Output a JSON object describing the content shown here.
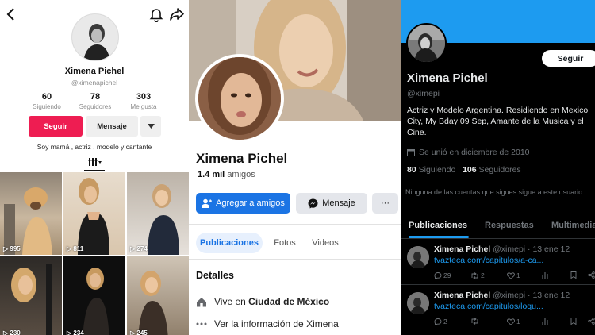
{
  "tiktok": {
    "name": "Ximena Pichel",
    "handle": "@ximenapichel",
    "stats": [
      {
        "value": "60",
        "label": "Siguiendo"
      },
      {
        "value": "78",
        "label": "Seguidores"
      },
      {
        "value": "303",
        "label": "Me gusta"
      }
    ],
    "follow_label": "Seguir",
    "message_label": "Mensaje",
    "bio": "Soy mamá , actriz , modelo y cantante",
    "videos": [
      {
        "views": "995"
      },
      {
        "views": "811"
      },
      {
        "views": "274"
      },
      {
        "views": "230"
      },
      {
        "views": "234"
      },
      {
        "views": "245"
      }
    ],
    "brand_color": "#ee1d52"
  },
  "facebook": {
    "name": "Ximena Pichel",
    "friends_count": "1.4 mil",
    "friends_label": "amigos",
    "add_friend_label": "Agregar a amigos",
    "message_label": "Mensaje",
    "more_label": "···",
    "tabs": [
      "Publicaciones",
      "Fotos",
      "Videos"
    ],
    "details_title": "Detalles",
    "lives_prefix": "Vive en",
    "lives_city": "Ciudad de México",
    "see_info": "Ver la información de Ximena",
    "brand_color": "#1b74e4"
  },
  "twitter": {
    "follow_label": "Seguir",
    "name": "Ximena Pichel",
    "handle": "@ximepi",
    "bio": "Actriz y Modelo Argentina. Residiendo en Mexico City, My Bday 09 Sep,  Amante de la Musica y el Cine.",
    "joined": "Se unió en diciembre de 2010",
    "following_count": "80",
    "following_label": "Siguiendo",
    "followers_count": "106",
    "followers_label": "Seguidores",
    "note": "Ninguna de las cuentas que sigues sigue a este usuario",
    "tabs": [
      "Publicaciones",
      "Respuestas",
      "Multimedia"
    ],
    "tweets": [
      {
        "name": "Ximena Pichel",
        "meta": "@ximepi · 13 ene 12",
        "link": "tvazteca.com/capitulos/a-ca...",
        "replies": "29",
        "retweets": "2",
        "likes": "1"
      },
      {
        "name": "Ximena Pichel",
        "meta": "@ximepi · 13 ene 12",
        "link": "tvazteca.com/capitulos/loqu...",
        "replies": "2",
        "retweets": "",
        "likes": "1"
      }
    ],
    "accent_color": "#1d9bf0"
  }
}
